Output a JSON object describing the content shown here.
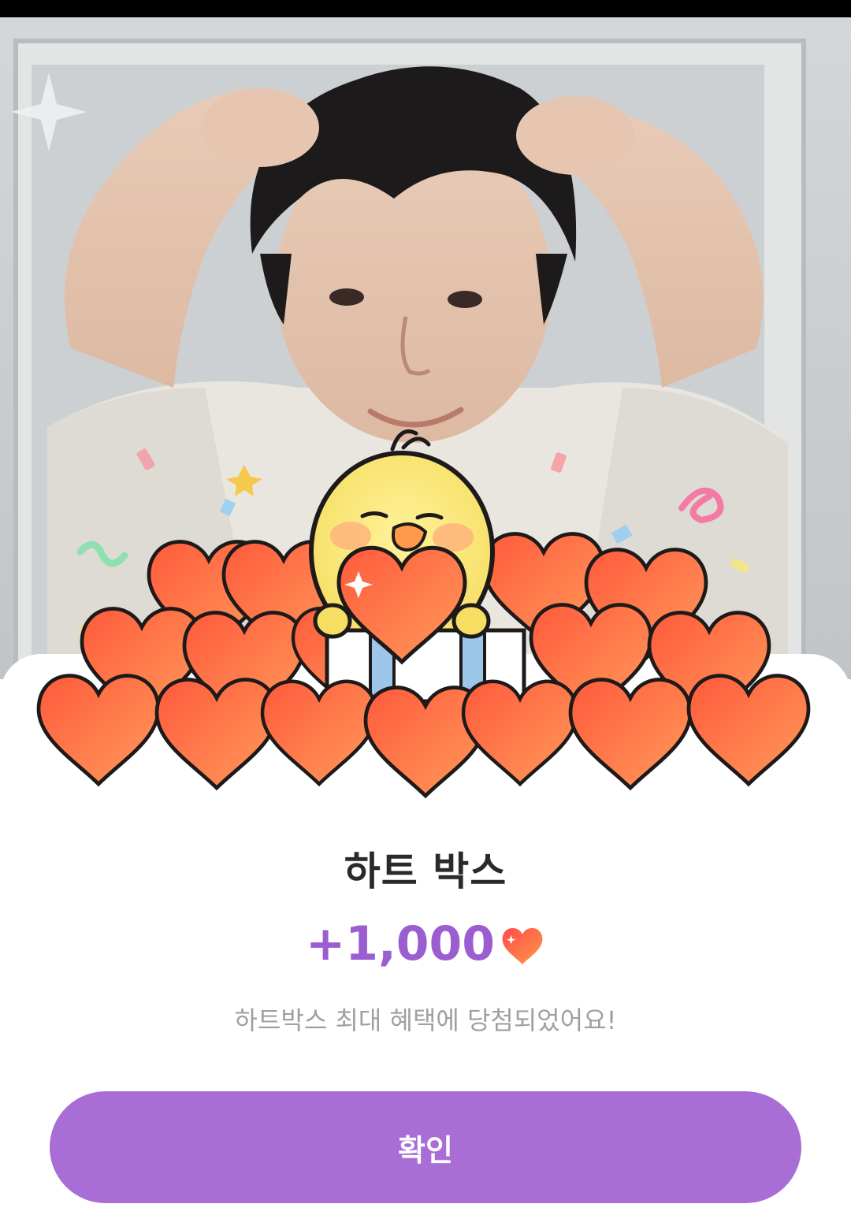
{
  "reward": {
    "title": "하트 박스",
    "amount": "+1,000",
    "currency_icon": "heart-icon",
    "message": "하트박스 최대 혜택에 당첨되었어요!"
  },
  "actions": {
    "confirm_label": "확인"
  },
  "colors": {
    "accent": "#a96dd6",
    "amount_text": "#9b5ed0",
    "heart": "#f26a3d"
  }
}
